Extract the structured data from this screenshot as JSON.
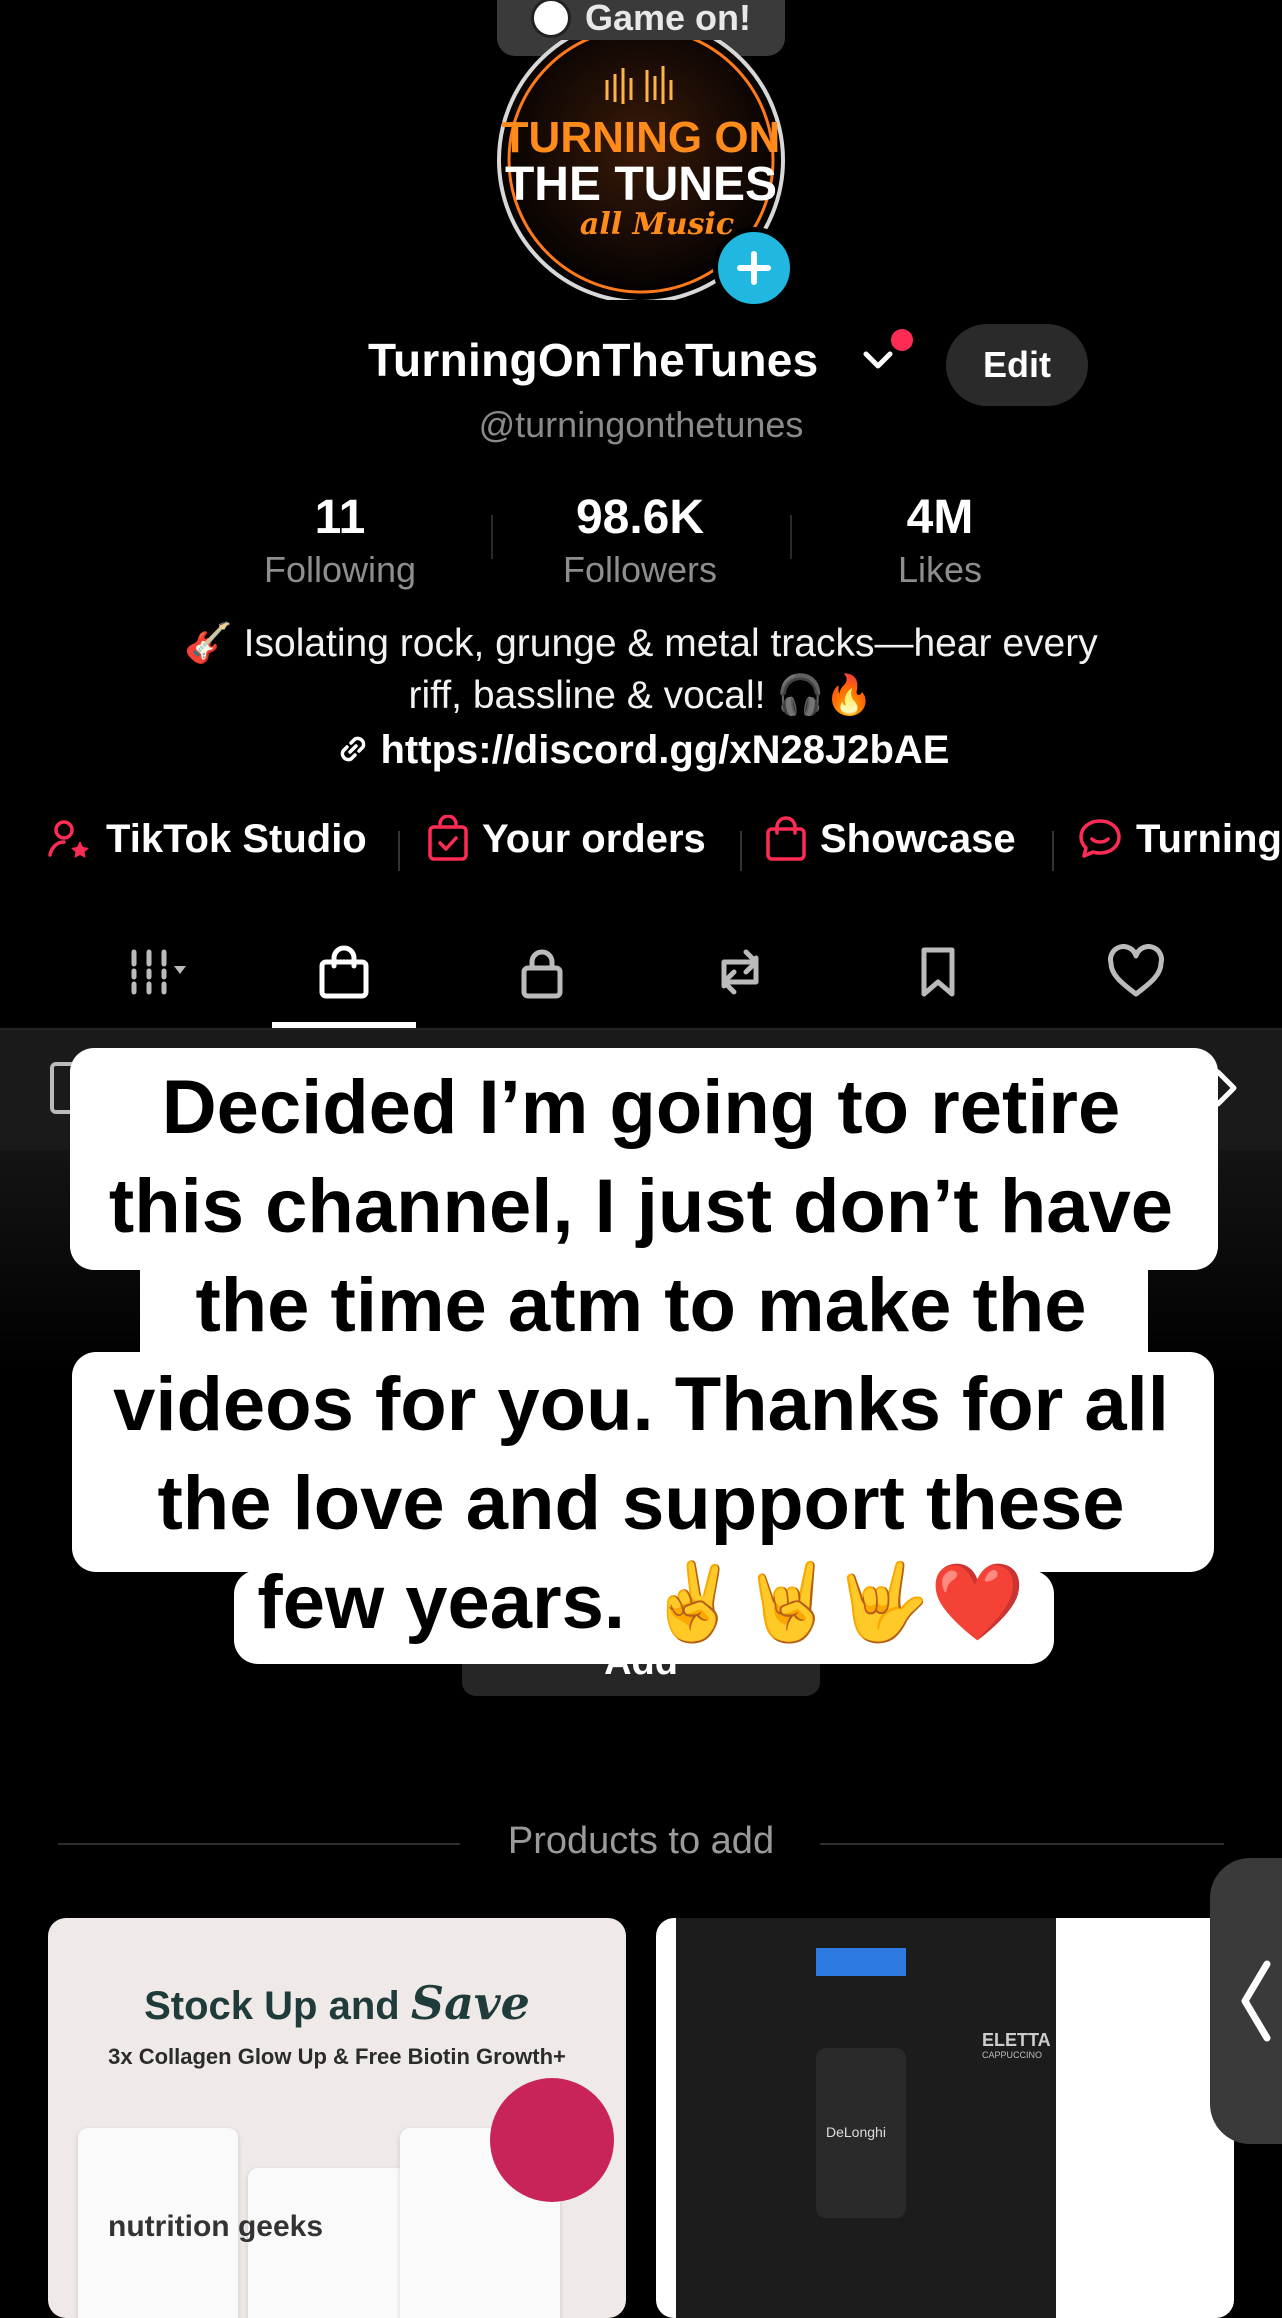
{
  "toast": {
    "text": "Game on!"
  },
  "avatar": {
    "line1": "TURNING ON",
    "line2": "THE TUNES",
    "line3": "all Music"
  },
  "profile": {
    "display_name": "TurningOnTheTunes",
    "handle": "@turningonthetunes",
    "edit_label": "Edit"
  },
  "stats": [
    {
      "value": "11",
      "label": "Following"
    },
    {
      "value": "98.6K",
      "label": "Followers"
    },
    {
      "value": "4M",
      "label": "Likes"
    }
  ],
  "bio": {
    "line1": "🎸 Isolating rock, grunge & metal tracks—hear every",
    "line2": "riff, bassline & vocal! 🎧🔥",
    "link": "https://discord.gg/xN28J2bAE"
  },
  "quick_links": [
    {
      "label": "TikTok Studio",
      "icon": "person-star-icon"
    },
    {
      "label": "Your orders",
      "icon": "order-bag-icon"
    },
    {
      "label": "Showcase",
      "icon": "shopping-bag-icon"
    },
    {
      "label": "Turning",
      "icon": "chat-bubble-icon"
    }
  ],
  "tabs": [
    {
      "icon": "grid-icon",
      "active": false
    },
    {
      "icon": "shopping-bag-icon",
      "active": true
    },
    {
      "icon": "lock-icon",
      "active": false
    },
    {
      "icon": "repost-icon",
      "active": false
    },
    {
      "icon": "bookmark-icon",
      "active": false
    },
    {
      "icon": "heart-icon",
      "active": false
    }
  ],
  "caption": {
    "lines": [
      "Decided I’m going to retire",
      "this channel, I just don’t have",
      "the time atm to make the",
      "videos for you. Thanks for all",
      "the love and support these",
      "few years. ✌️🤘🤟❤️"
    ]
  },
  "add_button": {
    "label": "Add"
  },
  "products": {
    "title": "Products to add",
    "card1": {
      "headline": "Stock Up and",
      "headline_script": "Save",
      "sub": "3x Collagen Glow Up & Free Biotin Growth+",
      "brand": "nutrition geeks"
    },
    "card2": {
      "brand": "ELETTA",
      "sub": "CAPPUCCINO",
      "maker": "DeLonghi"
    }
  },
  "colors": {
    "accent_red": "#fe2c55",
    "plus_blue": "#20b8e0"
  }
}
